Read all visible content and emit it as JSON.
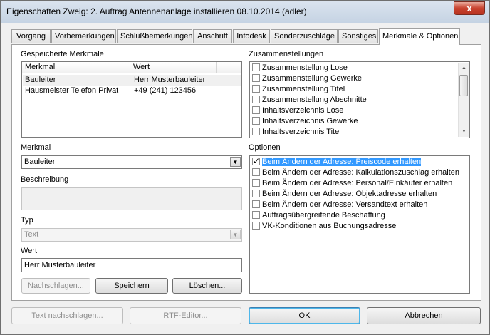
{
  "window": {
    "title": "Eigenschaften Zweig: 2. Auftrag Antennenanlage installieren 08.10.2014 (adler)",
    "close": "x"
  },
  "tabs": [
    {
      "label": "Vorgang"
    },
    {
      "label": "Vorbemerkungen"
    },
    {
      "label": "Schlußbemerkungen"
    },
    {
      "label": "Anschrift"
    },
    {
      "label": "Infodesk"
    },
    {
      "label": "Sonderzuschläge"
    },
    {
      "label": "Sonstiges"
    },
    {
      "label": "Merkmale & Optionen"
    }
  ],
  "gespeichert": {
    "label": "Gespeicherte Merkmale",
    "columns": [
      "Merkmal",
      "Wert"
    ],
    "rows": [
      {
        "merkmal": "Bauleiter",
        "wert": "Herr Musterbauleiter"
      },
      {
        "merkmal": "Hausmeister Telefon Privat",
        "wert": "+49 (241) 123456"
      }
    ]
  },
  "zusammenstellungen": {
    "label": "Zusammenstellungen",
    "items": [
      {
        "label": "Zusammenstellung Lose"
      },
      {
        "label": "Zusammenstellung Gewerke"
      },
      {
        "label": "Zusammenstellung Titel"
      },
      {
        "label": "Zusammenstellung Abschnitte"
      },
      {
        "label": "Inhaltsverzeichnis Lose"
      },
      {
        "label": "Inhaltsverzeichnis Gewerke"
      },
      {
        "label": "Inhaltsverzeichnis Titel"
      }
    ]
  },
  "merkmal": {
    "label": "Merkmal",
    "value": "Bauleiter"
  },
  "beschreibung": {
    "label": "Beschreibung",
    "value": ""
  },
  "typ": {
    "label": "Typ",
    "value": "Text"
  },
  "wert": {
    "label": "Wert",
    "value": "Herr Musterbauleiter"
  },
  "optionen": {
    "label": "Optionen",
    "items": [
      {
        "label": "Beim Ändern der Adresse: Preiscode erhalten",
        "checked": true
      },
      {
        "label": "Beim Ändern der Adresse: Kalkulationszuschlag erhalten",
        "checked": false
      },
      {
        "label": "Beim Ändern der Adresse: Personal/Einkäufer erhalten",
        "checked": false
      },
      {
        "label": "Beim Ändern der Adresse: Objektadresse erhalten",
        "checked": false
      },
      {
        "label": "Beim Ändern der Adresse: Versandtext erhalten",
        "checked": false
      },
      {
        "label": "Auftragsübergreifende Beschaffung",
        "checked": false
      },
      {
        "label": "VK-Konditionen aus Buchungsadresse",
        "checked": false
      }
    ]
  },
  "buttons": {
    "nachschlagen": "Nachschlagen...",
    "speichern": "Speichern",
    "loeschen": "Löschen...",
    "text_nachschlagen": "Text nachschlagen...",
    "rtf_editor": "RTF-Editor...",
    "ok": "OK",
    "abbrechen": "Abbrechen"
  }
}
